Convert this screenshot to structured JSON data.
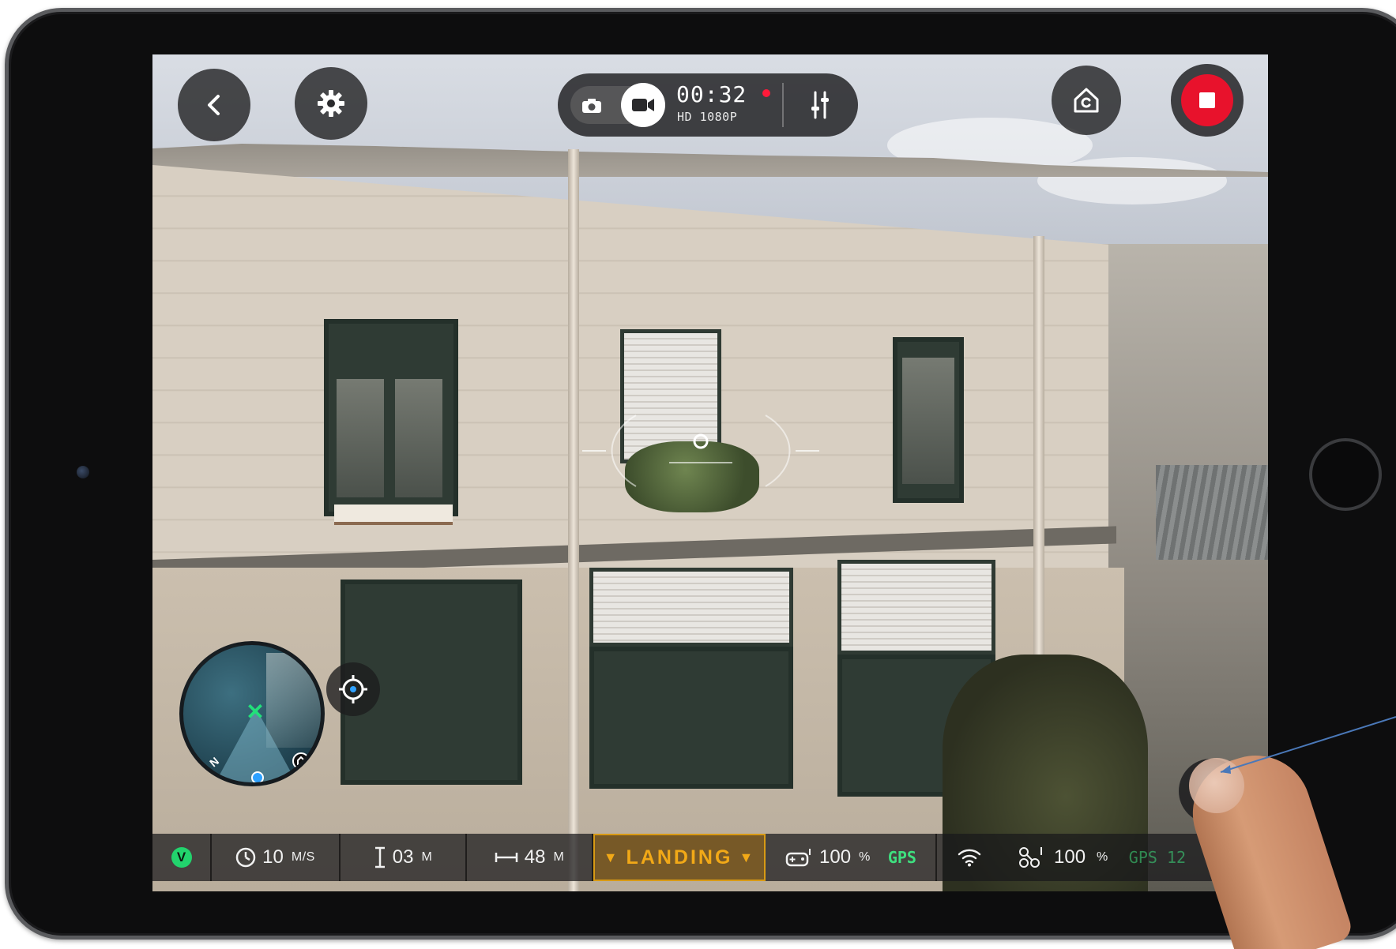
{
  "top_bar": {
    "back_icon": "chevron-left-icon",
    "settings_icon": "gear-icon",
    "timer": "00:32",
    "resolution": "HD 1080P",
    "photo_mode_icon": "camera-icon",
    "video_mode_icon": "video-camera-icon",
    "sliders_icon": "sliders-icon",
    "home_icon": "return-home-icon",
    "stop_icon": "stop-record-icon",
    "record_color": "#e8122c"
  },
  "minimap": {
    "north_label": "N",
    "drone_icon": "drone-icon",
    "home_icon": "home-icon",
    "user_icon": "user-location-icon"
  },
  "recenter_icon": "target-icon",
  "telemetry": {
    "badge": "V",
    "speed_value": "10",
    "speed_unit": "M/S",
    "altitude_value": "03",
    "altitude_unit": "M",
    "distance_value": "48",
    "distance_unit": "M",
    "flight_state": "LANDING",
    "controller_battery": "100",
    "controller_battery_unit": "%",
    "controller_gps": "GPS",
    "drone_battery": "100",
    "drone_battery_unit": "%",
    "drone_gps": "GPS 12"
  },
  "floating_photo_icon": "camera-icon",
  "colors": {
    "accent_green": "#22d36d",
    "landing_orange": "#f2a917",
    "hud_dark": "#1c1c1e"
  }
}
